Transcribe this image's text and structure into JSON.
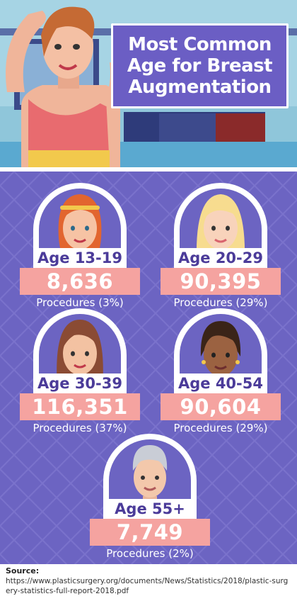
{
  "title": "Most Common Age for Breast Augmentation",
  "chart_data": {
    "type": "table",
    "title": "Most Common Age for Breast Augmentation",
    "categories": [
      "Age 13-19",
      "Age 20-29",
      "Age 30-39",
      "Age 40-54",
      "Age 55+"
    ],
    "values": [
      8636,
      90395,
      116351,
      90604,
      7749
    ],
    "items": [
      {
        "age": "Age 13-19",
        "count": "8,636",
        "procedures": "Procedures (3%)",
        "percent": 3
      },
      {
        "age": "Age 20-29",
        "count": "90,395",
        "procedures": "Procedures (29%)",
        "percent": 29
      },
      {
        "age": "Age 30-39",
        "count": "116,351",
        "procedures": "Procedures (37%)",
        "percent": 37
      },
      {
        "age": "Age 40-54",
        "count": "90,604",
        "procedures": "Procedures (29%)",
        "percent": 29
      },
      {
        "age": "Age 55+",
        "count": "7,749",
        "procedures": "Procedures (2%)",
        "percent": 2
      }
    ]
  },
  "source": {
    "label": "Source:",
    "url": "https://www.plasticsurgery.org/documents/News/Statistics/2018/plastic-surgery-statistics-full-report-2018.pdf"
  },
  "colors": {
    "panel": "#6c64c2",
    "title_box": "#6b5ec4",
    "count_box": "#f5a3a0",
    "age_text": "#4b3b99"
  },
  "icons": [
    "woman-illustration",
    "redhead-face-icon",
    "blonde-face-icon",
    "brunette-face-icon",
    "dark-skin-face-icon",
    "gray-hair-face-icon"
  ]
}
